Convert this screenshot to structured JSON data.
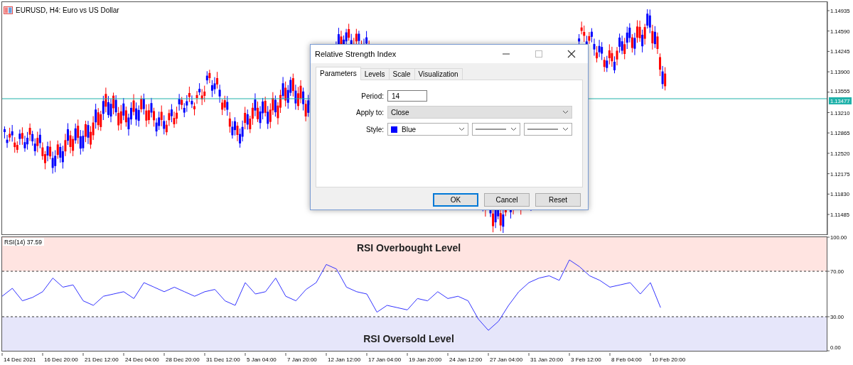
{
  "chart": {
    "title": "EURUSD, H4:  Euro vs US Dollar",
    "price_axis": [
      "1.14935",
      "1.14590",
      "1.14245",
      "1.13900",
      "1.13555",
      "1.13210",
      "1.12865",
      "1.12520",
      "1.12175",
      "1.11830",
      "1.11485"
    ],
    "current_price": "1.13477"
  },
  "dialog": {
    "title": "Relative Strength Index",
    "tabs": [
      {
        "label": "Parameters",
        "selected": true
      },
      {
        "label": "Levels",
        "selected": false
      },
      {
        "label": "Scale",
        "selected": false
      },
      {
        "label": "Visualization",
        "selected": false
      }
    ],
    "period": {
      "label": "Period:",
      "value": "14"
    },
    "apply_to": {
      "label": "Apply to:",
      "value": "Close"
    },
    "style": {
      "label": "Style:",
      "color_name": "Blue",
      "color": "#0000ff"
    },
    "buttons": [
      {
        "label": "OK",
        "selected": true
      },
      {
        "label": "Cancel",
        "selected": false
      },
      {
        "label": "Reset",
        "selected": false
      }
    ]
  },
  "rsi": {
    "value": "37.59",
    "overbought_label": "RSI Overbought Level",
    "oversold_label": "RSI Oversold Level",
    "chart_data": {
      "type": "line",
      "ylim": [
        0,
        100
      ],
      "yticks": [
        {
          "value": 100,
          "label": "100.00"
        },
        {
          "value": 70,
          "label": "70.00"
        },
        {
          "value": 30,
          "label": "30.00"
        },
        {
          "value": 0,
          "label": "0.00"
        }
      ],
      "series": [
        {
          "name": "RSI(14)",
          "color": "#3333ff",
          "values": [
            48,
            55,
            44,
            47,
            52,
            64,
            56,
            58,
            44,
            40,
            48,
            50,
            52,
            46,
            60,
            56,
            52,
            56,
            52,
            48,
            52,
            54,
            44,
            40,
            60,
            50,
            52,
            64,
            48,
            44,
            54,
            60,
            76,
            72,
            56,
            52,
            50,
            34,
            40,
            38,
            36,
            46,
            44,
            52,
            46,
            48,
            44,
            28,
            18,
            26,
            40,
            52,
            60,
            64,
            66,
            62,
            80,
            74,
            66,
            62,
            56,
            58,
            60,
            50,
            60,
            38
          ]
        }
      ]
    }
  },
  "time_axis": [
    "14 Dec 2021",
    "16 Dec 20:00",
    "21 Dec 12:00",
    "24 Dec 04:00",
    "28 Dec 20:00",
    "31 Dec 12:00",
    "5 Jan 04:00",
    "7 Jan 20:00",
    "12 Jan 12:00",
    "17 Jan 04:00",
    "19 Jan 20:00",
    "24 Jan 12:00",
    "27 Jan 04:00",
    "31 Jan 20:00",
    "3 Feb 12:00",
    "8 Feb 04:00",
    "10 Feb 20:00"
  ]
}
